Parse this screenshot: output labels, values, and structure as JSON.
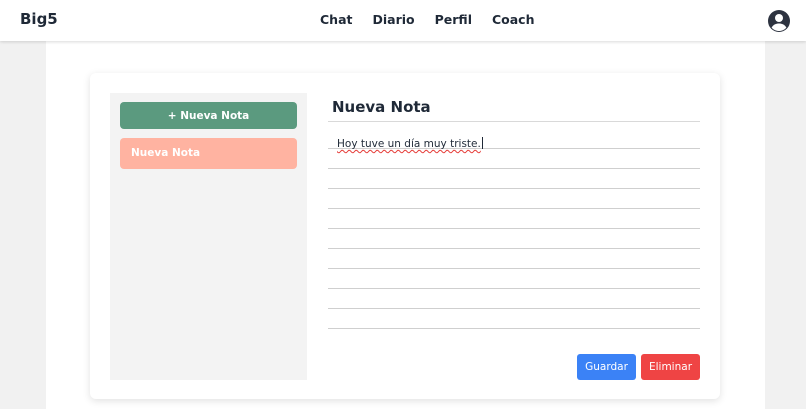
{
  "header": {
    "brand": "Big5",
    "nav": [
      "Chat",
      "Diario",
      "Perfil",
      "Coach"
    ],
    "avatar_icon": "user-circle-icon"
  },
  "sidebar": {
    "new_note_label": "+ Nueva Nota",
    "notes": [
      "Nueva Nota"
    ]
  },
  "editor": {
    "title": "Nueva Nota",
    "content": "Hoy tuve un día muy triste.",
    "save_label": "Guardar",
    "delete_label": "Eliminar"
  },
  "colors": {
    "new_note_button": "#5b9a7f",
    "note_item": "#ffb3a1",
    "save_button": "#3b82f6",
    "delete_button": "#ef4444"
  }
}
